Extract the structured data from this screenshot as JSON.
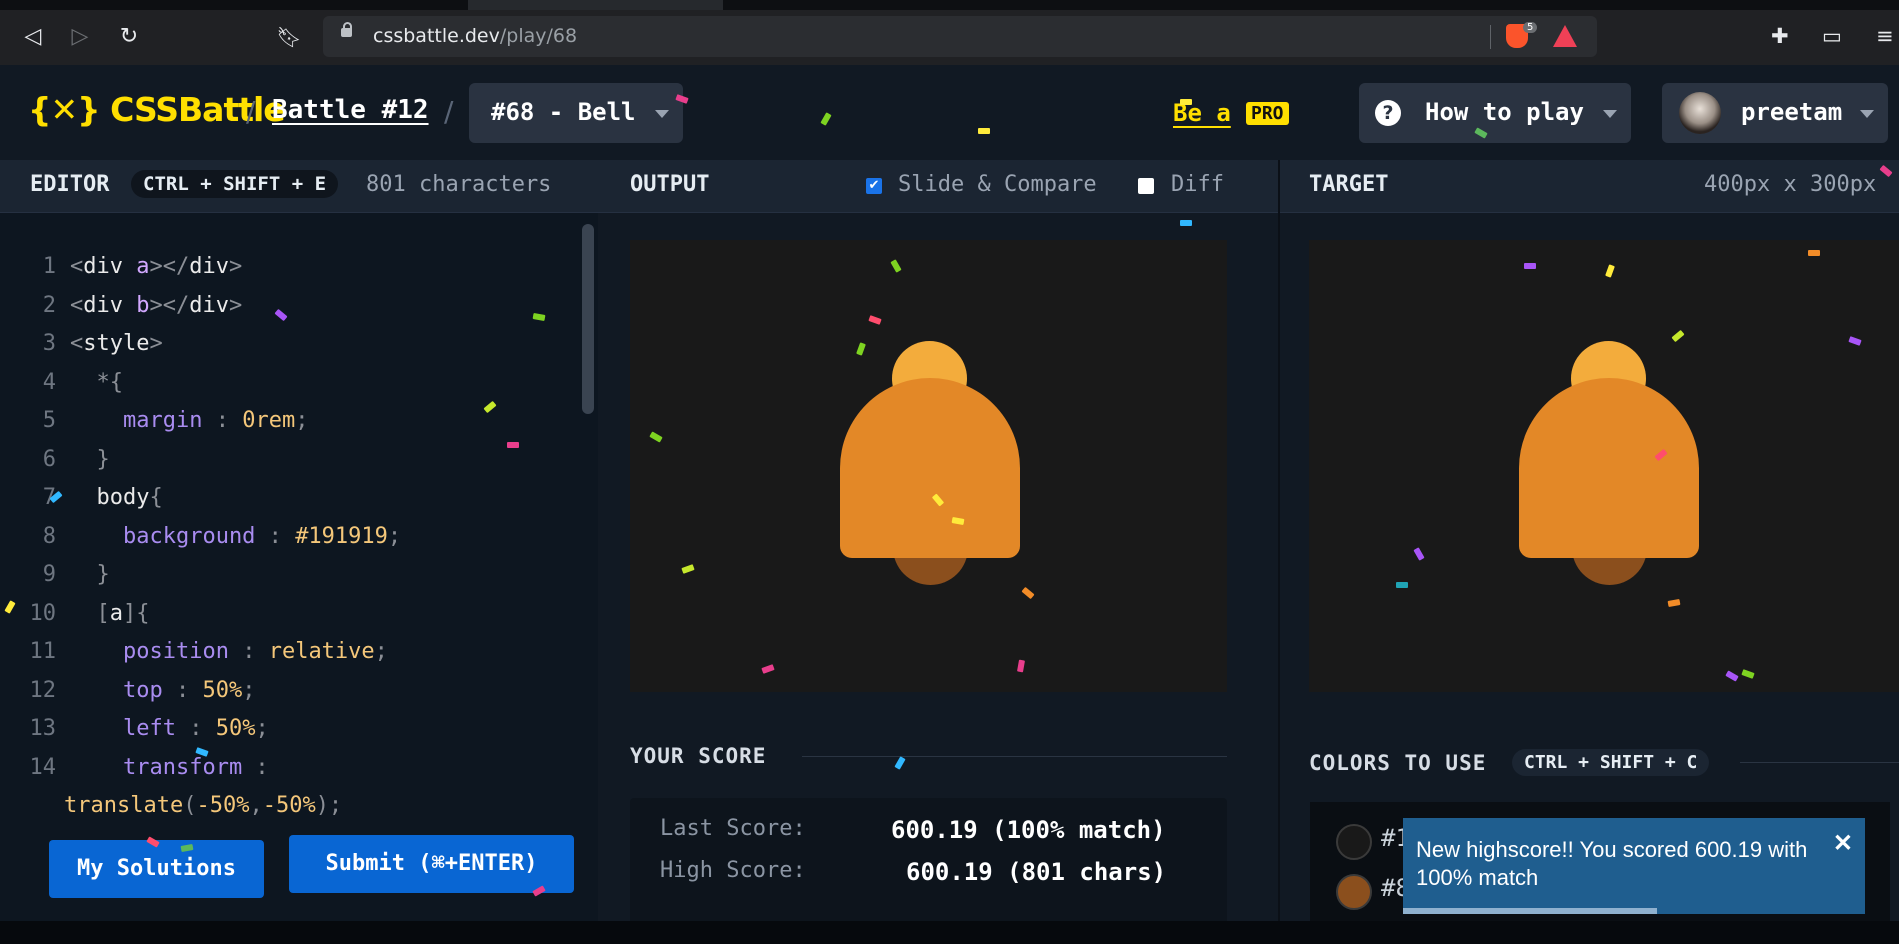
{
  "browser": {
    "url_domain": "cssbattle.dev",
    "url_path": "/play/68",
    "brave_shield_count": "5",
    "icons": [
      "back-icon",
      "forward-icon",
      "reload-icon",
      "bookmark-icon",
      "lock-icon",
      "brave-shield-icon",
      "brave-rewards-icon",
      "extensions-icon",
      "wallet-icon",
      "menu-icon"
    ]
  },
  "header": {
    "logo_mark": "{✕}",
    "logo_text": "CSSBattle",
    "sep": "/",
    "battle": "Battle #12",
    "target_selector": "#68 - Bell",
    "be_a": "Be a",
    "pro": "PRO",
    "how_to_play": "How to play",
    "username": "preetam"
  },
  "editor": {
    "label": "EDITOR",
    "shortcut": "CTRL + SHIFT + E",
    "char_count": "801 characters",
    "lines": [
      {
        "n": "1",
        "seg": [
          [
            "pu",
            "<"
          ],
          [
            "tg",
            "div"
          ],
          [
            "at",
            " a"
          ],
          [
            "pu",
            ">"
          ],
          [
            "pu",
            "</"
          ],
          [
            "tg",
            "div"
          ],
          [
            "pu",
            ">"
          ]
        ]
      },
      {
        "n": "2",
        "seg": [
          [
            "pu",
            "<"
          ],
          [
            "tg",
            "div"
          ],
          [
            "at",
            " b"
          ],
          [
            "pu",
            ">"
          ],
          [
            "pu",
            "</"
          ],
          [
            "tg",
            "div"
          ],
          [
            "pu",
            ">"
          ]
        ]
      },
      {
        "n": "3",
        "seg": [
          [
            "pu",
            "<"
          ],
          [
            "tg",
            "style"
          ],
          [
            "pu",
            ">"
          ]
        ]
      },
      {
        "n": "4",
        "seg": [
          [
            "pu",
            "  *{"
          ]
        ]
      },
      {
        "n": "5",
        "seg": [
          [
            "pr",
            "    margin"
          ],
          [
            "pu",
            " : "
          ],
          [
            "va",
            "0rem"
          ],
          [
            "pu",
            ";"
          ]
        ]
      },
      {
        "n": "6",
        "seg": [
          [
            "pu",
            "  }"
          ]
        ]
      },
      {
        "n": "7",
        "seg": [
          [
            "tg",
            "  body"
          ],
          [
            "pu",
            "{"
          ]
        ]
      },
      {
        "n": "8",
        "seg": [
          [
            "pr",
            "    background"
          ],
          [
            "pu",
            " : "
          ],
          [
            "va",
            "#191919"
          ],
          [
            "pu",
            ";"
          ]
        ]
      },
      {
        "n": "9",
        "seg": [
          [
            "pu",
            "  }"
          ]
        ]
      },
      {
        "n": "10",
        "seg": [
          [
            "pu",
            "  ["
          ],
          [
            "tg",
            "a"
          ],
          [
            "pu",
            "]{"
          ]
        ]
      },
      {
        "n": "11",
        "seg": [
          [
            "pr",
            "    position"
          ],
          [
            "pu",
            " : "
          ],
          [
            "va",
            "relative"
          ],
          [
            "pu",
            ";"
          ]
        ]
      },
      {
        "n": "12",
        "seg": [
          [
            "pr",
            "    top"
          ],
          [
            "pu",
            " : "
          ],
          [
            "va",
            "50%"
          ],
          [
            "pu",
            ";"
          ]
        ]
      },
      {
        "n": "13",
        "seg": [
          [
            "pr",
            "    left"
          ],
          [
            "pu",
            " : "
          ],
          [
            "va",
            "50%"
          ],
          [
            "pu",
            ";"
          ]
        ]
      },
      {
        "n": "14",
        "seg": [
          [
            "pr",
            "    transform"
          ],
          [
            "pu",
            " :"
          ]
        ]
      },
      {
        "n": "",
        "seg": [
          [
            "va",
            "translate"
          ],
          [
            "pu",
            "("
          ],
          [
            "va",
            "-50%"
          ],
          [
            "pu",
            ","
          ],
          [
            "va",
            "-50%"
          ],
          [
            "pu",
            ");"
          ]
        ]
      }
    ],
    "my_solutions": "My Solutions",
    "submit": "Submit (⌘+ENTER)"
  },
  "output": {
    "label": "OUTPUT",
    "slide_compare": "Slide & Compare",
    "slide_compare_checked": true,
    "diff": "Diff",
    "diff_checked": false,
    "score_title": "YOUR SCORE",
    "last_score_label": "Last Score:",
    "last_score_value": "600.19 (100% match)",
    "high_score_label": "High Score:",
    "high_score_value": "600.19 (801 chars)"
  },
  "target": {
    "label": "TARGET",
    "size": "400px x 300px",
    "colors_title": "COLORS TO USE",
    "colors_shortcut": "CTRL + SHIFT + C",
    "swatch_1_label": "#1",
    "swatch_2_label": "#8",
    "swatch_1_color": "#191919",
    "swatch_2_color": "#8B4F1D"
  },
  "bell": {
    "top_color": "#F3AC3C",
    "body_color": "#E38827",
    "clapper_color": "#8B4F1D",
    "bg_color": "#191919"
  },
  "toast": {
    "message": "New highscore!! You scored 600.19 with 100% match",
    "close": "✕",
    "progress": 0.55
  },
  "colors": {
    "brand_yellow": "#FFDF00",
    "button_blue": "#0966D3"
  }
}
